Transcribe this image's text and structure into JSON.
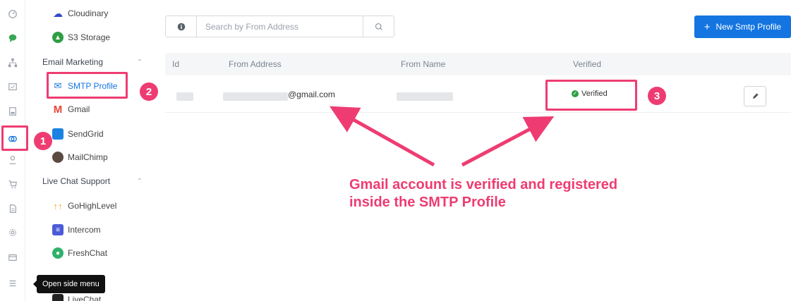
{
  "rail": {
    "icons": [
      "dashboard-icon",
      "chat-icon",
      "sitemap-icon",
      "campaign-icon",
      "save-icon",
      "integrations-icon",
      "user-icon",
      "cart-icon",
      "document-icon",
      "settings-icon",
      "card-icon",
      "menu-icon"
    ]
  },
  "sidebar": {
    "cloudinary": "Cloudinary",
    "s3": "S3 Storage",
    "email_marketing": "Email Marketing",
    "smtp_profile": "SMTP Profile",
    "gmail": "Gmail",
    "sendgrid": "SendGrid",
    "mailchimp": "MailChimp",
    "live_chat_support": "Live Chat Support",
    "gohighlevel": "GoHighLevel",
    "intercom": "Intercom",
    "freshchat": "FreshChat",
    "livechat": "LiveChat"
  },
  "search": {
    "placeholder": "Search by From Address"
  },
  "new_button": {
    "label": "New Smtp Profile"
  },
  "table": {
    "headers": {
      "id": "Id",
      "from_address": "From Address",
      "from_name": "From Name",
      "verified": "Verified"
    },
    "rows": [
      {
        "from_address": "@gmail.com",
        "verified": "Verified"
      }
    ]
  },
  "annotations": {
    "badge1": "1",
    "badge2": "2",
    "badge3": "3",
    "line1": "Gmail account is verified and registered",
    "line2": "inside the SMTP Profile",
    "color": "#ee3c72"
  },
  "tooltip": {
    "text": "Open side menu"
  }
}
